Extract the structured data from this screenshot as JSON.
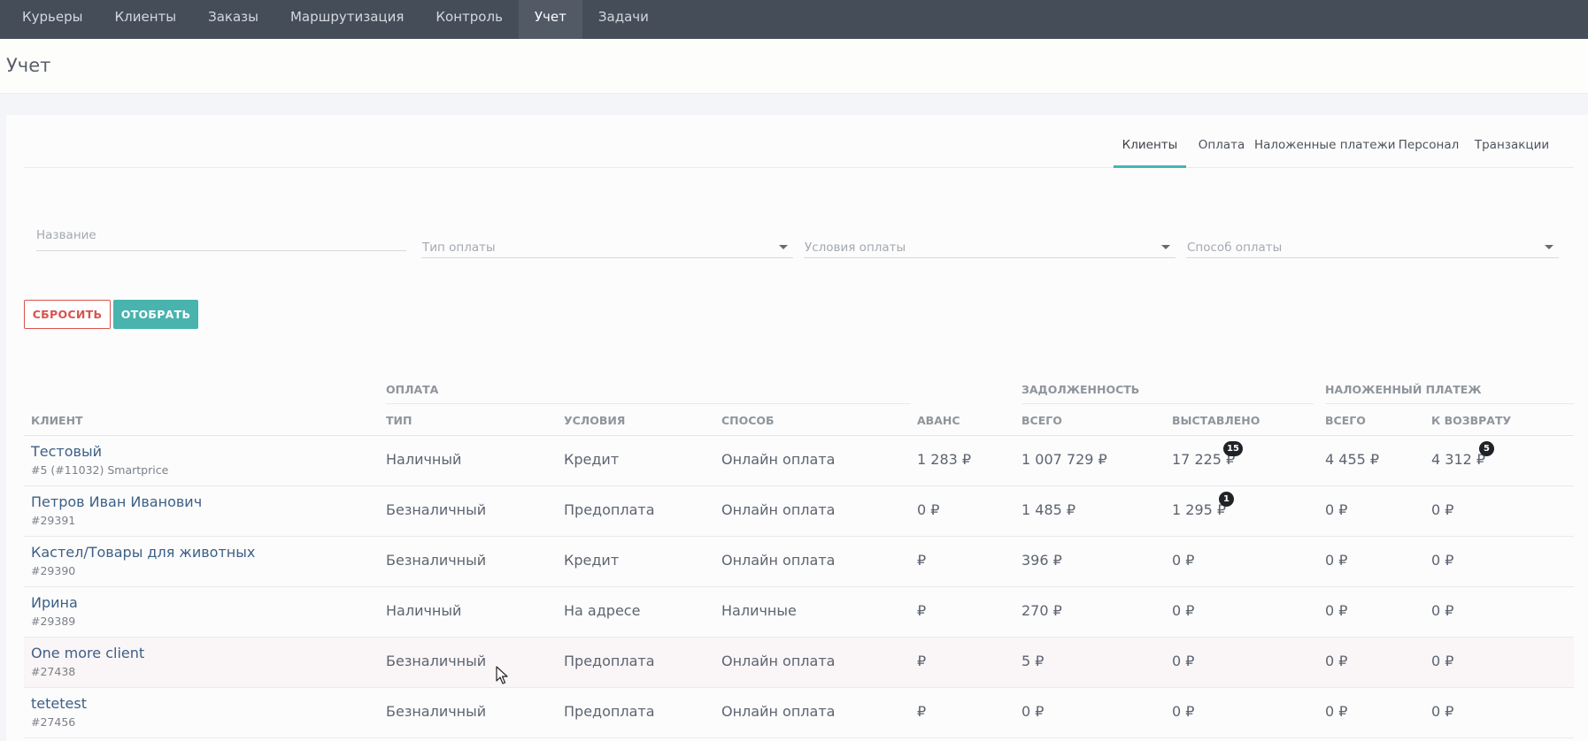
{
  "nav": {
    "items": [
      {
        "label": "Курьеры",
        "active": false
      },
      {
        "label": "Клиенты",
        "active": false
      },
      {
        "label": "Заказы",
        "active": false
      },
      {
        "label": "Маршрутизация",
        "active": false
      },
      {
        "label": "Контроль",
        "active": false
      },
      {
        "label": "Учет",
        "active": true
      },
      {
        "label": "Задачи",
        "active": false
      }
    ]
  },
  "page": {
    "title": "Учет"
  },
  "subtabs": {
    "items": [
      {
        "label": "Клиенты",
        "active": true
      },
      {
        "label": "Оплата",
        "active": false
      },
      {
        "label": "Наложенные платежи",
        "active": false
      },
      {
        "label": "Персонал",
        "active": false
      },
      {
        "label": "Транзакции",
        "active": false
      }
    ]
  },
  "filters": {
    "name_placeholder": "Название",
    "payment_type_placeholder": "Тип оплаты",
    "payment_terms_placeholder": "Условия оплаты",
    "payment_method_placeholder": "Способ оплаты"
  },
  "buttons": {
    "reset": "СБРОСИТЬ",
    "select": "ОТОБРАТЬ"
  },
  "table": {
    "groups": {
      "payment": "ОПЛАТА",
      "debt": "ЗАДОЛЖЕННОСТЬ",
      "cod": "НАЛОЖЕННЫЙ ПЛАТЕЖ"
    },
    "columns": {
      "client": "КЛИЕНТ",
      "type": "ТИП",
      "terms": "УСЛОВИЯ",
      "method": "СПОСОБ",
      "advance": "АВАНС",
      "debt_total": "ВСЕГО",
      "debt_invoiced": "ВЫСТАВЛЕНО",
      "cod_total": "ВСЕГО",
      "cod_refund": "К ВОЗВРАТУ"
    },
    "rows": [
      {
        "name": "Тестовый",
        "id": "#5 (#11032) Smartprice",
        "type": "Наличный",
        "terms": "Кредит",
        "method": "Онлайн оплата",
        "advance": "1 283 ₽",
        "debt_total": "1 007 729 ₽",
        "debt_invoiced": "17 225 ₽",
        "invoiced_badge": "15",
        "cod_total": "4 455 ₽",
        "cod_refund": "4 312 ₽",
        "refund_badge": "5"
      },
      {
        "name": "Петров Иван Иванович",
        "id": "#29391",
        "type": "Безналичный",
        "terms": "Предоплата",
        "method": "Онлайн оплата",
        "advance": "0 ₽",
        "debt_total": "1 485 ₽",
        "debt_invoiced": "1 295 ₽",
        "invoiced_badge": "1",
        "cod_total": "0 ₽",
        "cod_refund": "0 ₽"
      },
      {
        "name": "Кастел/Товары для животных",
        "id": "#29390",
        "type": "Безналичный",
        "terms": "Кредит",
        "method": "Онлайн оплата",
        "advance": "₽",
        "debt_total": "396 ₽",
        "debt_invoiced": "0 ₽",
        "cod_total": "0 ₽",
        "cod_refund": "0 ₽"
      },
      {
        "name": "Ирина",
        "id": "#29389",
        "type": "Наличный",
        "terms": "На адресе",
        "method": "Наличные",
        "advance": "₽",
        "debt_total": "270 ₽",
        "debt_invoiced": "0 ₽",
        "cod_total": "0 ₽",
        "cod_refund": "0 ₽"
      },
      {
        "name": "One more client",
        "id": "#27438",
        "type": "Безналичный",
        "terms": "Предоплата",
        "method": "Онлайн оплата",
        "advance": "₽",
        "debt_total": "5 ₽",
        "debt_invoiced": "0 ₽",
        "cod_total": "0 ₽",
        "cod_refund": "0 ₽"
      },
      {
        "name": "tetetest",
        "id": "#27456",
        "type": "Безналичный",
        "terms": "Предоплата",
        "method": "Онлайн оплата",
        "advance": "₽",
        "debt_total": "0 ₽",
        "debt_invoiced": "0 ₽",
        "cod_total": "0 ₽",
        "cod_refund": "0 ₽"
      }
    ]
  },
  "colors": {
    "accent": "#45b5b1",
    "danger": "#d9534f",
    "nav_bg": "#454d59",
    "link": "#3d5f86"
  }
}
